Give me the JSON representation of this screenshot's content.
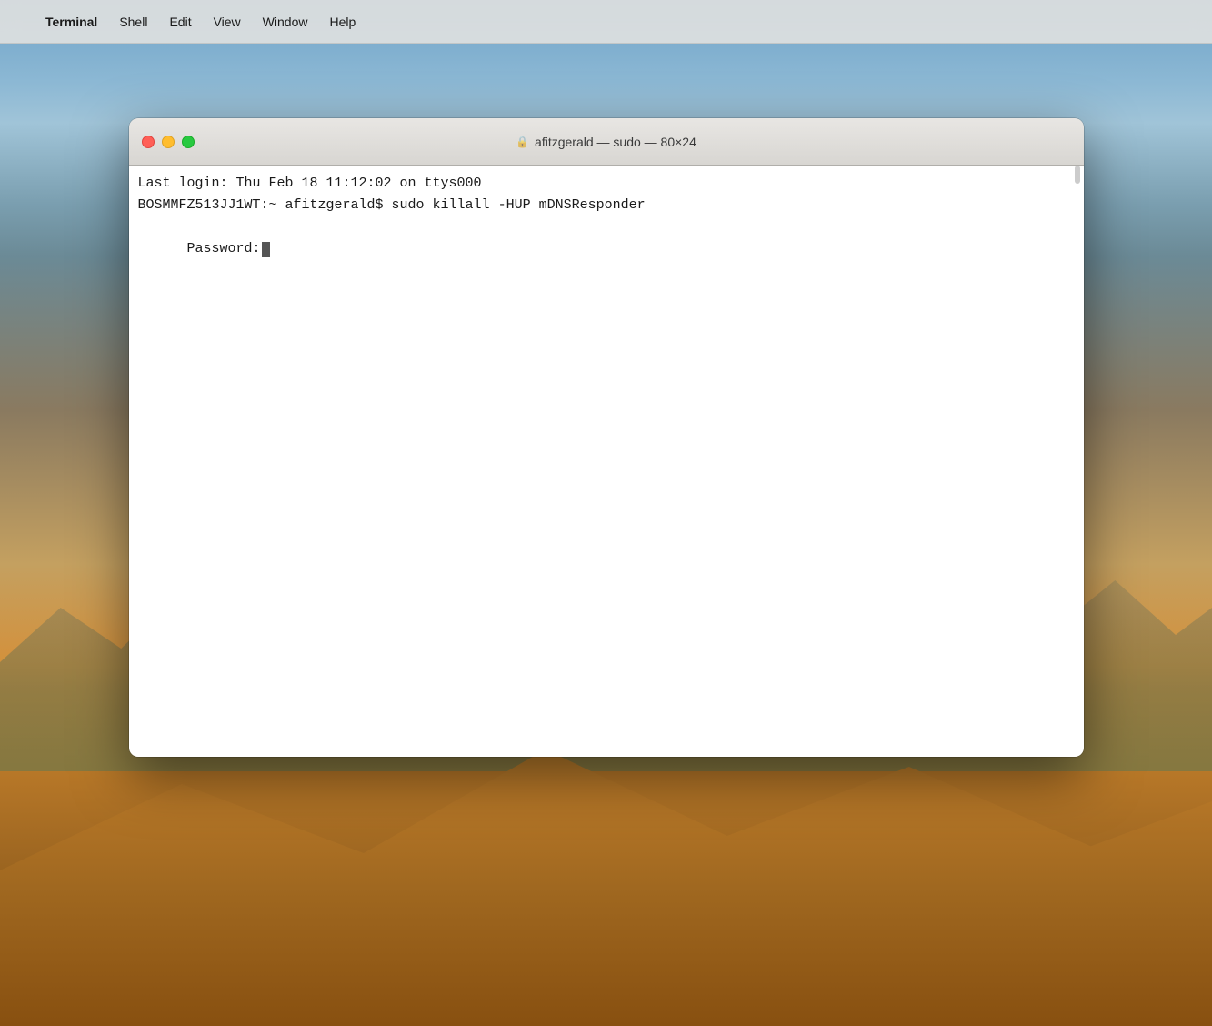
{
  "desktop": {
    "background_description": "macOS Mojave desert wallpaper"
  },
  "menubar": {
    "apple_symbol": "",
    "items": [
      {
        "id": "apple",
        "label": ""
      },
      {
        "id": "terminal",
        "label": "Terminal"
      },
      {
        "id": "shell",
        "label": "Shell"
      },
      {
        "id": "edit",
        "label": "Edit"
      },
      {
        "id": "view",
        "label": "View"
      },
      {
        "id": "window",
        "label": "Window"
      },
      {
        "id": "help",
        "label": "Help"
      }
    ]
  },
  "terminal_window": {
    "title": "afitzgerald — sudo — 80×24",
    "lock_icon": "🔒",
    "buttons": {
      "close": "close",
      "minimize": "minimize",
      "maximize": "maximize"
    },
    "content": {
      "line1": "Last login: Thu Feb 18 11:12:02 on ttys000",
      "line2": "BOSMMFZ513JJ1WT:~ afitzgerald$ sudo killall -HUP mDNSResponder",
      "line3_prefix": "Password:"
    }
  }
}
